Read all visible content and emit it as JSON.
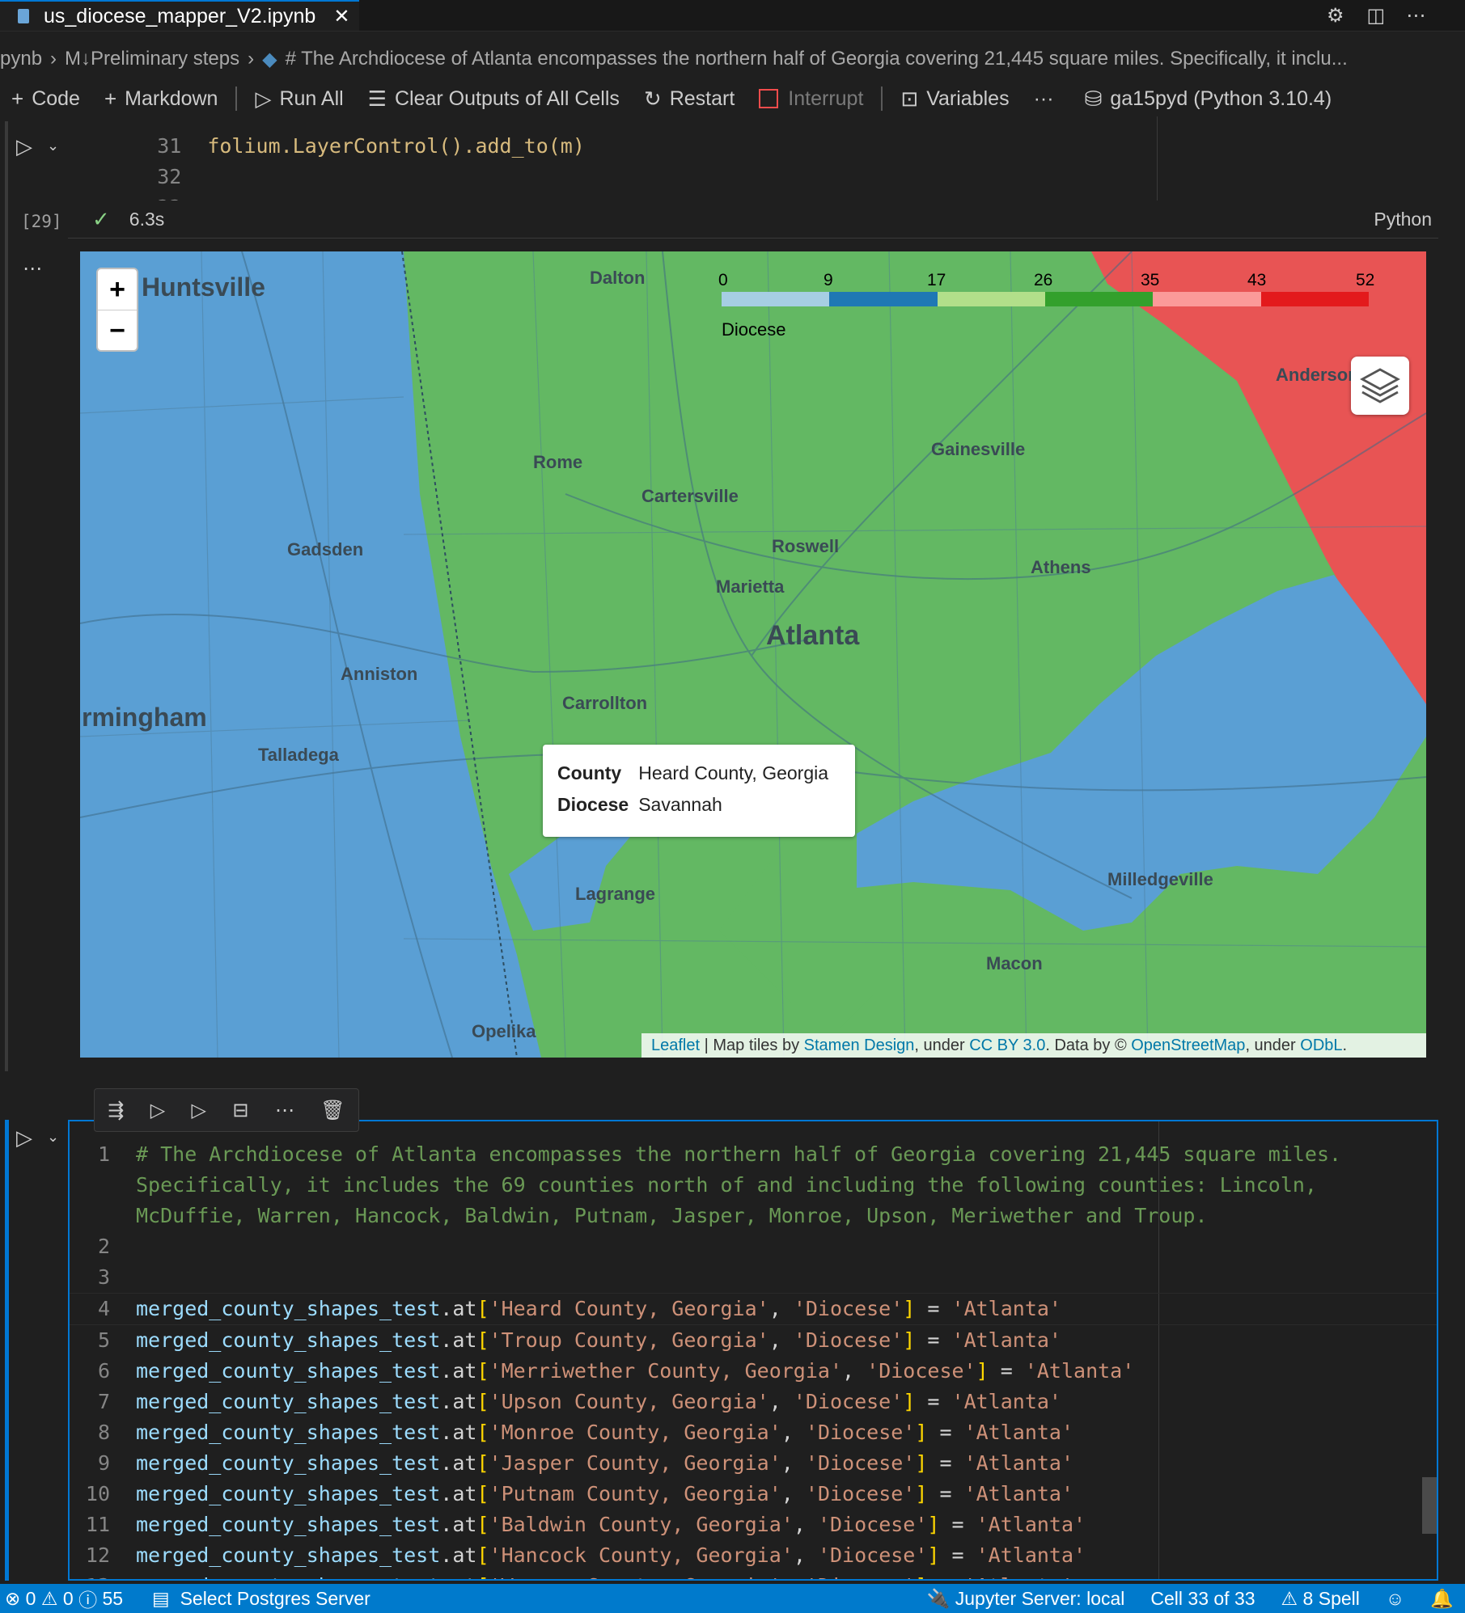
{
  "tab": {
    "filename": "us_diocese_mapper_V2.ipynb"
  },
  "breadcrumb": {
    "items": [
      "pynb",
      "M↓Preliminary steps",
      "# The Archdiocese of Atlanta encompasses the northern half of Georgia covering 21,445 square miles. Specifically, it inclu..."
    ]
  },
  "toolbar": {
    "code": "Code",
    "markdown": "Markdown",
    "run_all": "Run All",
    "clear_outputs": "Clear Outputs of All Cells",
    "restart": "Restart",
    "interrupt": "Interrupt",
    "variables": "Variables",
    "more": "···",
    "kernel": "ga15pyd (Python 3.10.4)"
  },
  "prev_cell": {
    "lines": [
      {
        "num": "31",
        "text": "folium.LayerControl().add_to(m)"
      },
      {
        "num": "32",
        "text": ""
      },
      {
        "num": "33",
        "text": "m"
      }
    ],
    "exec_count": "[29]",
    "duration": "6.3s",
    "language": "Python"
  },
  "map": {
    "colors": {
      "light_blue": "#a6cee3",
      "blue": "#1f78b4",
      "light_green": "#b2df8a",
      "green": "#33a02c",
      "pink": "#fb9a99",
      "red": "#e31a1c",
      "region_blue": "#5a9fd4",
      "region_green": "#63b863",
      "region_red": "#e85454"
    },
    "zoom_in": "+",
    "zoom_out": "−",
    "legend": {
      "ticks": [
        "0",
        "9",
        "17",
        "26",
        "35",
        "43",
        "52"
      ],
      "caption": "Diocese"
    },
    "cities": [
      "Huntsville",
      "Dalton",
      "Rome",
      "Cartersville",
      "Gainesville",
      "Gadsden",
      "Roswell",
      "Marietta",
      "Athens",
      "Atlanta",
      "Anniston",
      "Carrollton",
      "Birmingham",
      "Talladega",
      "Lagrange",
      "Milledgeville",
      "Macon",
      "Opelika",
      "Anderson"
    ],
    "tooltip": {
      "county_label": "County",
      "county_value": "Heard County, Georgia",
      "diocese_label": "Diocese",
      "diocese_value": "Savannah"
    },
    "attribution": {
      "leaflet": "Leaflet",
      "tiles_prefix": " | Map tiles by ",
      "stamen": "Stamen Design",
      "under1": ", under ",
      "ccby": "CC BY 3.0",
      "data_by": ". Data by © ",
      "osm": "OpenStreetMap",
      "under2": ", under ",
      "odbl": "ODbL",
      "end": "."
    }
  },
  "active_cell": {
    "comment": "# The Archdiocese of Atlanta encompasses the northern half of Georgia covering 21,445 square miles. Specifically, it includes the 69 counties north of and including the following counties: Lincoln, McDuffie, Warren, Hancock, Baldwin, Putnam, Jasper, Monroe, Upson, Meriwether and Troup.",
    "code_lines": [
      {
        "num": "4",
        "county": "Heard County, Georgia"
      },
      {
        "num": "5",
        "county": "Troup County, Georgia"
      },
      {
        "num": "6",
        "county": "Merriwether County, Georgia"
      },
      {
        "num": "7",
        "county": "Upson County, Georgia"
      },
      {
        "num": "8",
        "county": "Monroe County, Georgia"
      },
      {
        "num": "9",
        "county": "Jasper County, Georgia"
      },
      {
        "num": "10",
        "county": "Putnam County, Georgia"
      },
      {
        "num": "11",
        "county": "Baldwin County, Georgia"
      },
      {
        "num": "12",
        "county": "Hancock County, Georgia"
      },
      {
        "num": "13",
        "county": "Warren County, Georgia"
      }
    ],
    "var_name": "merged_county_shapes_test",
    "accessor": ".at",
    "key": "'Diocese'",
    "value": "'Atlanta'"
  },
  "statusbar": {
    "errors": "0",
    "warnings": "0",
    "infos": "55",
    "postgres": "Select Postgres Server",
    "jupyter": "Jupyter Server: local",
    "cell_pos": "Cell 33 of 33",
    "spell": "8 Spell"
  }
}
